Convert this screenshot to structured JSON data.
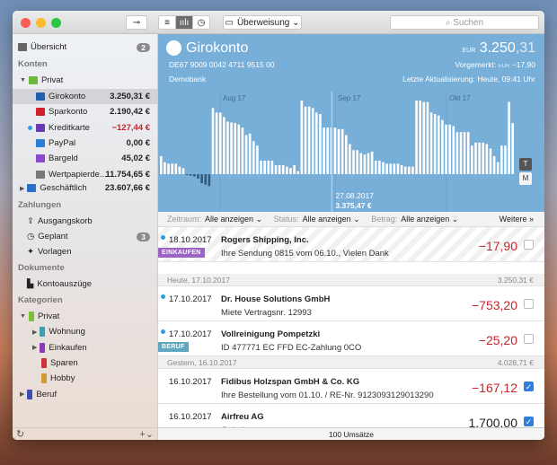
{
  "toolbar": {
    "transfer": "Überweisung",
    "search_placeholder": "Suchen"
  },
  "sidebar": {
    "overview": "Übersicht",
    "overview_badge": "2",
    "accounts_header": "Konten",
    "privat": "Privat",
    "accounts": [
      {
        "label": "Girokonto",
        "amount": "3.250,31 €",
        "color": "#1f5fb0"
      },
      {
        "label": "Sparkonto",
        "amount": "2.190,42 €",
        "color": "#d0222a"
      },
      {
        "label": "Kreditkarte",
        "amount": "−127,44 €",
        "color": "#6a3ab8"
      },
      {
        "label": "PayPal",
        "amount": "0,00 €",
        "color": "#2a7fd8"
      },
      {
        "label": "Bargeld",
        "amount": "45,02 €",
        "color": "#8a48d0"
      },
      {
        "label": "Wertpapierde...",
        "amount": "11.754,65 €",
        "color": "#777"
      }
    ],
    "business": "Geschäftlich",
    "business_amount": "23.607,66 €",
    "payments_header": "Zahlungen",
    "outbox": "Ausgangskorb",
    "scheduled": "Geplant",
    "scheduled_badge": "3",
    "templates": "Vorlagen",
    "documents_header": "Dokumente",
    "statements": "Kontoauszüge",
    "categories_header": "Kategorien",
    "categories": [
      {
        "label": "Privat",
        "color": "#7cbf3a"
      },
      {
        "label": "Wohnung",
        "color": "#3aa0b0"
      },
      {
        "label": "Einkaufen",
        "color": "#8a3ab8"
      },
      {
        "label": "Sparen",
        "color": "#d0303a"
      },
      {
        "label": "Hobby",
        "color": "#d09a30"
      },
      {
        "label": "Beruf",
        "color": "#3a4fb8"
      }
    ]
  },
  "account": {
    "name": "Girokonto",
    "iban": "DE67 9009 0042 4711 9515 00",
    "bank": "Demobank",
    "currency": "EUR",
    "balance_int": "3.250",
    "balance_dec": ",31",
    "pending_label": "Vorgemerkt:",
    "pending_currency": "EUR",
    "pending": "−17,90",
    "updated": "Letzte Aktualisierung: Heute, 09:41 Uhr"
  },
  "chart_data": {
    "type": "bar",
    "months": [
      "Aug 17",
      "Sep 17",
      "Okt 17"
    ],
    "tooltip_date": "27.08.2017",
    "tooltip_value": "3.375,47 €",
    "toggle": [
      "T",
      "M"
    ],
    "values": [
      1200,
      800,
      700,
      700,
      700,
      500,
      400,
      -40,
      -100,
      -160,
      -300,
      -600,
      -700,
      -800,
      4400,
      4100,
      4100,
      3800,
      3500,
      3440,
      3400,
      3300,
      3100,
      2600,
      2700,
      2200,
      1900,
      900,
      900,
      900,
      900,
      600,
      600,
      600,
      500,
      400,
      600,
      200,
      4900,
      4500,
      4500,
      4400,
      4100,
      4000,
      3100,
      3100,
      3100,
      3100,
      3000,
      3000,
      2600,
      2000,
      1600,
      1600,
      1400,
      1300,
      1400,
      1500,
      900,
      900,
      800,
      700,
      700,
      700,
      700,
      600,
      500,
      500,
      500,
      4900,
      4900,
      4800,
      4800,
      4100,
      4000,
      3900,
      3600,
      3300,
      3300,
      3200,
      2800,
      2800,
      2800,
      2800,
      1900,
      2100,
      2100,
      2100,
      2000,
      1700,
      1200,
      800,
      1900,
      1900,
      4800,
      3400
    ],
    "highlight_index": 45
  },
  "filters": [
    {
      "label": "Zeitraum:",
      "value": "Alle anzeigen"
    },
    {
      "label": "Status:",
      "value": "Alle anzeigen"
    },
    {
      "label": "Betrag:",
      "value": "Alle anzeigen"
    }
  ],
  "more": "Weitere",
  "groups": [
    {
      "label": "Heute, 17.10.2017",
      "balance": "3.250,31 €"
    },
    {
      "label": "Gestern, 16.10.2017",
      "balance": "4.028,71 €"
    }
  ],
  "transactions": [
    {
      "date": "18.10.2017",
      "payee": "Rogers Shipping, Inc.",
      "purpose": "Ihre Sendung 0815 vom 06.10., Vielen Dank",
      "amount": "−17,90",
      "tag": "EINKAUFEN",
      "tag_color": "#9a63c4"
    },
    {
      "date": "17.10.2017",
      "payee": "Dr. House Solutions GmbH",
      "purpose": "Miete Vertragsnr. 12993",
      "amount": "−753,20"
    },
    {
      "date": "17.10.2017",
      "payee": "Vollreinigung Pompetzki",
      "purpose": "ID 477771 EC FFD EC-Zahlung 0CO",
      "amount": "−25,20",
      "tag": "BERUF",
      "tag_color": "#5fa8c0"
    },
    {
      "date": "16.10.2017",
      "payee": "Fidibus Holzspan GmbH & Co. KG",
      "purpose": "Ihre Bestellung vom 01.10. / RE-Nr. 9123093129013290",
      "amount": "−167,12"
    },
    {
      "date": "16.10.2017",
      "payee": "Airfreu AG",
      "purpose": "Gehalt",
      "amount": "1.700,00"
    }
  ],
  "footer": "100 Umsätze"
}
